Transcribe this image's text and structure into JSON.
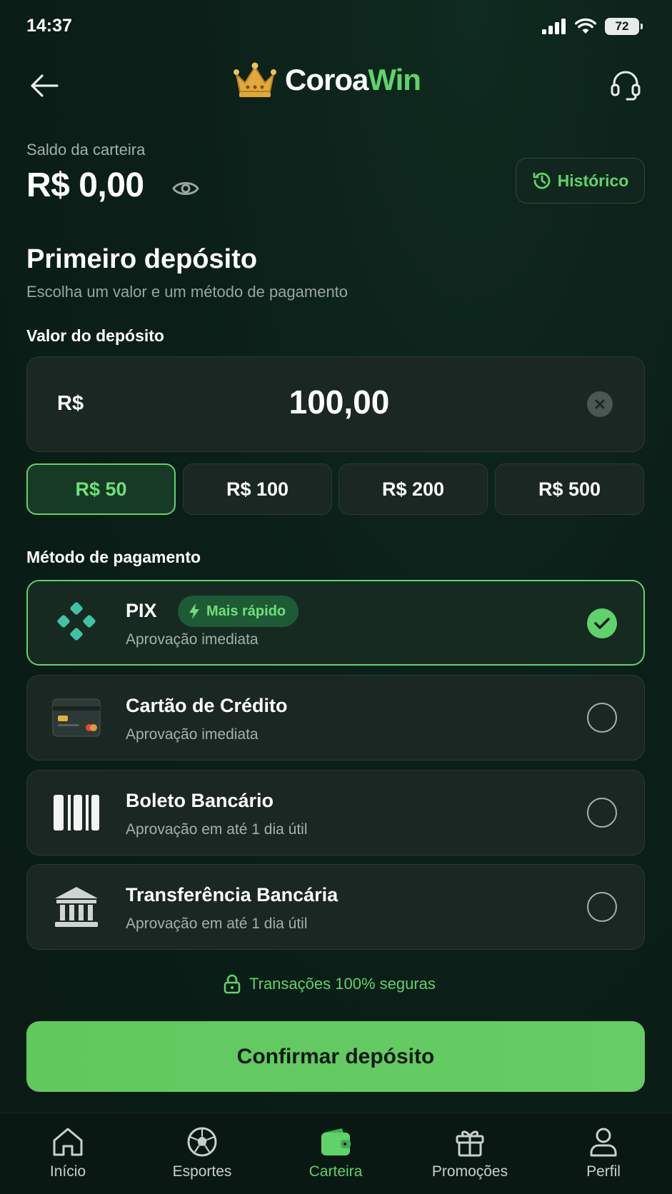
{
  "status_bar": {
    "time": "14:37",
    "battery": "72"
  },
  "header": {
    "logo_part1": "Coroa",
    "logo_part2": "Win",
    "back_icon": "arrow-left-icon",
    "support_icon": "headset-icon"
  },
  "wallet": {
    "label": "Saldo da carteira",
    "balance": "R$ 0,00",
    "history_label": "Histórico"
  },
  "deposit": {
    "title": "Primeiro depósito",
    "subtitle": "Escolha um valor e um método de pagamento",
    "amount_label": "Valor do depósito",
    "currency": "R$",
    "amount": "100,00",
    "quick_amounts": [
      "R$ 50",
      "R$ 100",
      "R$ 200",
      "R$ 500"
    ],
    "selected_quick_index": 0
  },
  "payment": {
    "heading": "Método de pagamento",
    "methods": [
      {
        "name": "PIX",
        "desc": "Aprovação imediata",
        "badge": "Mais rápido",
        "selected": true,
        "icon": "pix-icon"
      },
      {
        "name": "Cartão de Crédito",
        "desc": "Aprovação imediata",
        "selected": false,
        "icon": "credit-card-icon"
      },
      {
        "name": "Boleto Bancário",
        "desc": "Aprovação em até 1 dia útil",
        "selected": false,
        "icon": "barcode-icon"
      },
      {
        "name": "Transferência Bancária",
        "desc": "Aprovação em até 1 dia útil",
        "selected": false,
        "icon": "bank-icon"
      }
    ]
  },
  "secure_note": "Transações 100% seguras",
  "confirm_label": "Confirmar depósito",
  "nav": [
    {
      "label": "Início",
      "icon": "home-icon"
    },
    {
      "label": "Esportes",
      "icon": "soccer-ball-icon"
    },
    {
      "label": "Carteira",
      "icon": "wallet-icon",
      "active": true
    },
    {
      "label": "Promoções",
      "icon": "gift-icon"
    },
    {
      "label": "Perfil",
      "icon": "user-icon"
    }
  ],
  "colors": {
    "accent": "#5fd36a",
    "background": "#0b1f18",
    "card": "#1b2723",
    "gold": "#e3a83a"
  }
}
